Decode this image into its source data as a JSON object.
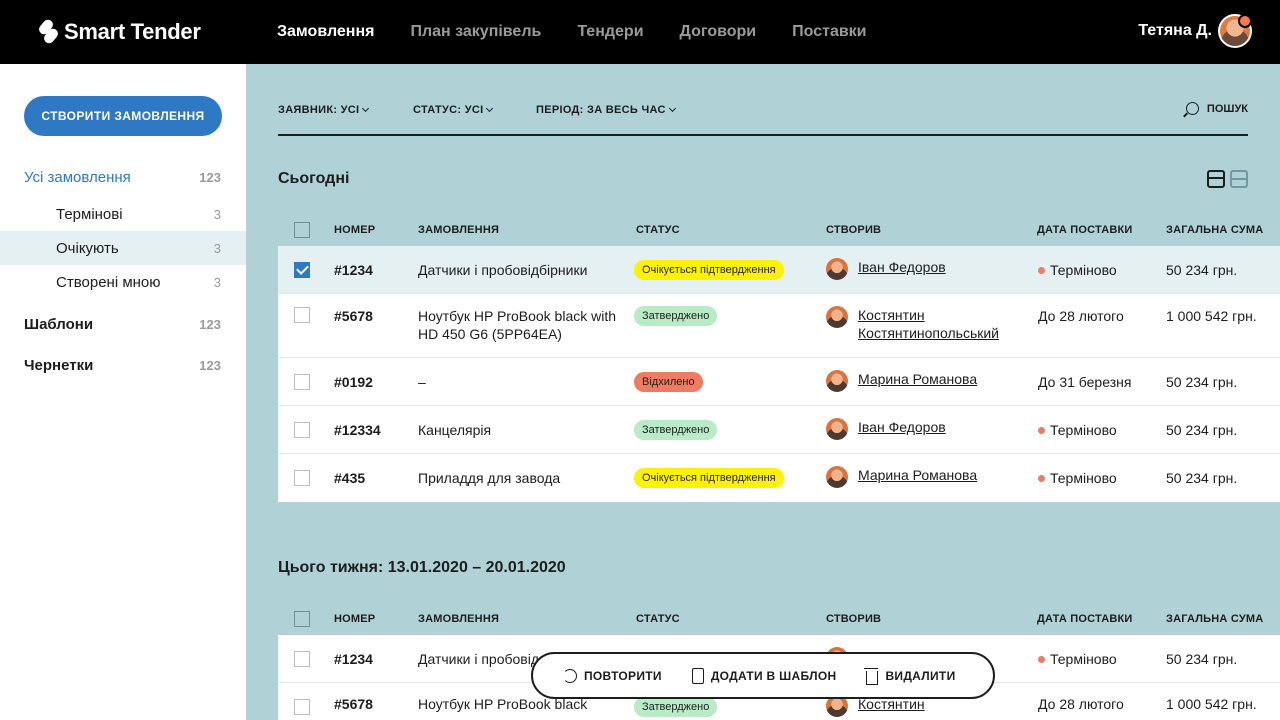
{
  "brand": {
    "name": "Smart Tender"
  },
  "nav": [
    "Замовлення",
    "План закупівель",
    "Тендери",
    "Договори",
    "Поставки"
  ],
  "user": {
    "name": "Тетяна Д."
  },
  "sidebar": {
    "create_button": "СТВОРИТИ ЗАМОВЛЕННЯ",
    "items": [
      {
        "label": "Усі замовлення",
        "count": "123"
      },
      {
        "label": "Термінові",
        "count": "3"
      },
      {
        "label": "Очікують",
        "count": "3"
      },
      {
        "label": "Створені мною",
        "count": "3"
      },
      {
        "label": "Шаблони",
        "count": "123"
      },
      {
        "label": "Чернетки",
        "count": "123"
      }
    ]
  },
  "filters": {
    "applicant": "ЗАЯВНИК: УСІ",
    "status": "СТАТУС: УСІ",
    "period": "ПЕРІОД: ЗА ВЕСЬ ЧАС",
    "search": "ПОШУК"
  },
  "columns": [
    "НОМЕР",
    "ЗАМОВЛЕННЯ",
    "СТАТУС",
    "СТВОРИВ",
    "ДАТА ПОСТАВКИ",
    "ЗАГАЛЬНА СУМА"
  ],
  "sections": [
    {
      "title": "Сьогодні",
      "rows": [
        {
          "number": "#1234",
          "order": "Датчики і пробовідбірники",
          "status": "Очікується підтвердження",
          "creator": "Іван Федоров",
          "date": "Терміново",
          "sum": "50 234 грн."
        },
        {
          "number": "#5678",
          "order": "Ноутбук HP ProBook black with HD 450 G6 (5PP64EA)",
          "status": "Затверджено",
          "creator": "Костянтин Костянтинопольський",
          "date": "До 28 лютого",
          "sum": "1 000 542 грн."
        },
        {
          "number": "#0192",
          "order": "–",
          "status": "Відхилено",
          "creator": "Марина Романова",
          "date": "До 31 березня",
          "sum": "50 234 грн."
        },
        {
          "number": "#12334",
          "order": "Канцелярія",
          "status": "Затверджено",
          "creator": "Іван Федоров",
          "date": "Терміново",
          "sum": "50 234 грн."
        },
        {
          "number": "#435",
          "order": "Приладдя для завода",
          "status": "Очікується підтвердження",
          "creator": "Марина Романова",
          "date": "Терміново",
          "sum": "50 234 грн."
        }
      ]
    },
    {
      "title": "Цього тижня: 13.01.2020 – 20.01.2020",
      "rows": [
        {
          "number": "#1234",
          "order": "Датчики і пробовід",
          "status": "",
          "creator": "",
          "date": "Терміново",
          "sum": "50 234 грн."
        },
        {
          "number": "#5678",
          "order": "Ноутбук HP ProBook black",
          "status": "Затверджено",
          "creator": "Костянтин",
          "date": "До 28 лютого",
          "sum": "1 000 542 грн."
        }
      ]
    }
  ],
  "actions": [
    "ПОВТОРИТИ",
    "ДОДАТИ В ШАБЛОН",
    "ВИДАЛИТИ"
  ],
  "colors": {
    "accent": "#2f79c4",
    "background": "#b0d2d6",
    "pending": "#fff200",
    "approved": "#b9ecc6",
    "rejected": "#f07a62"
  }
}
